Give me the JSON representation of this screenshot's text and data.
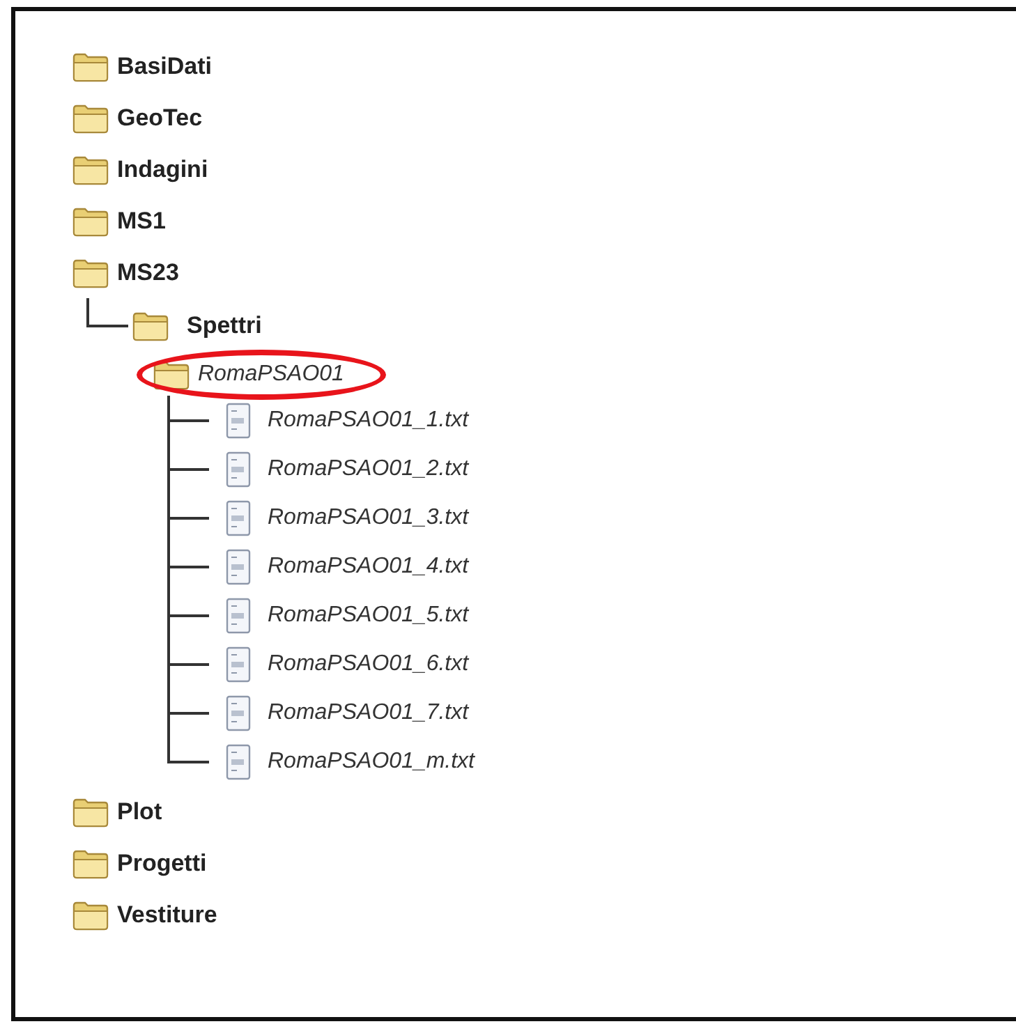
{
  "tree": [
    {
      "kind": "folder",
      "label": "BasiDati"
    },
    {
      "kind": "folder",
      "label": "GeoTec"
    },
    {
      "kind": "folder",
      "label": "Indagini"
    },
    {
      "kind": "folder",
      "label": "MS1"
    },
    {
      "kind": "folder",
      "label": "MS23",
      "children": [
        {
          "kind": "folder",
          "label": "Spettri",
          "connector": true,
          "children": [
            {
              "kind": "folder",
              "label": "RomaPSAO01",
              "connector": false,
              "circled": true,
              "children": [
                {
                  "kind": "file",
                  "label": "RomaPSAO01_1.txt",
                  "connector": true
                },
                {
                  "kind": "file",
                  "label": "RomaPSAO01_2.txt",
                  "connector": true
                },
                {
                  "kind": "file",
                  "label": "RomaPSAO01_3.txt",
                  "connector": true
                },
                {
                  "kind": "file",
                  "label": "RomaPSAO01_4.txt",
                  "connector": true
                },
                {
                  "kind": "file",
                  "label": "RomaPSAO01_5.txt",
                  "connector": true
                },
                {
                  "kind": "file",
                  "label": "RomaPSAO01_6.txt",
                  "connector": true
                },
                {
                  "kind": "file",
                  "label": "RomaPSAO01_7.txt",
                  "connector": true
                },
                {
                  "kind": "file",
                  "label": "RomaPSAO01_m.txt",
                  "connector": true
                }
              ]
            }
          ]
        }
      ]
    },
    {
      "kind": "folder",
      "label": "Plot"
    },
    {
      "kind": "folder",
      "label": "Progetti"
    },
    {
      "kind": "folder",
      "label": "Vestiture"
    }
  ]
}
